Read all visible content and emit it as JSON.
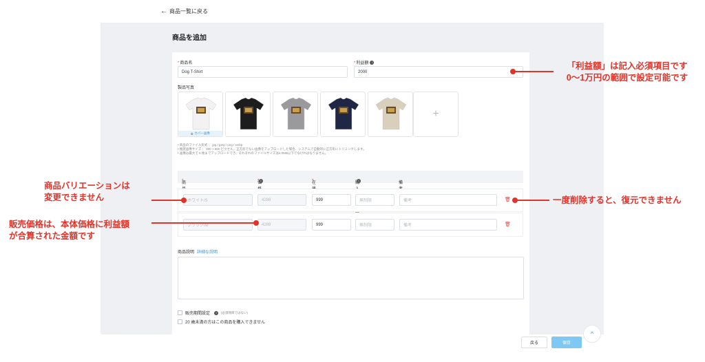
{
  "header": {
    "back_label": "商品一覧に戻る",
    "page_title": "商品を追加"
  },
  "form": {
    "product_name_label": "商品名",
    "product_name_value": "Dog T-Shirt",
    "profit_label": "利益額",
    "profit_value": "2000",
    "photos_label": "製品写真",
    "cover_label": "カバー画像",
    "photos": [
      {
        "color": "#f2f2f2"
      },
      {
        "color": "#1d1d1d"
      },
      {
        "color": "#9a9a9d"
      },
      {
        "color": "#1f2744"
      },
      {
        "color": "#d9cfbd"
      }
    ],
    "photo_notes": [
      "商品のファイル形式 ： jpg / jpeg / png / webp",
      "推奨画像サイズ ： 800 × 800 ピクセル。正方形でない画像をアップロードした場合、システムで自動的に正方形にトリミングします。",
      "画像は最大で 5 枚までアップロードでき、それぞれのファイルサイズは4.0MB以下でなければなりません。"
    ]
  },
  "variations": {
    "headers": {
      "variation": "商品バリエーション",
      "price": "価格",
      "stock": "在庫",
      "limit": "購入個数制限",
      "remarks": "備考"
    },
    "rows": [
      {
        "variation": "ホワイト/S",
        "price": "4288",
        "stock": "999",
        "limit": "無制限",
        "remarks": "備考"
      },
      {
        "variation": "ブラック/M",
        "price": "4288",
        "stock": "999",
        "limit": "無制限",
        "remarks": "備考"
      }
    ]
  },
  "description": {
    "label": "商品説明",
    "link": "詳細な説明"
  },
  "options": {
    "sale_period_label": "販売期間設定",
    "sale_period_note": "(必須項目ではない)",
    "age_restriction_label": "20 歳未満の方はこの商品を購入できません"
  },
  "footer": {
    "back_button": "戻る",
    "save_button": "保存"
  },
  "annotations": {
    "profit_line1": "「利益額」は記入必須項目です",
    "profit_line2": "0〜1万円の範囲で設定可能です",
    "variation_line1": "商品バリエーションは",
    "variation_line2": "変更できません",
    "price_line1": "販売価格は、本体価格に利益額",
    "price_line2": "が合算された金額です",
    "delete_text": "一度削除すると、復元できません"
  },
  "colors": {
    "annotation": "#e0342b",
    "accent": "#3a9bd5",
    "save_button": "#7fc8f4"
  }
}
